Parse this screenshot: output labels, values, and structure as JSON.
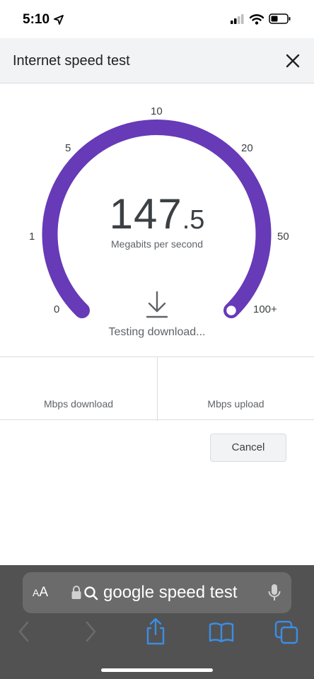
{
  "status_bar": {
    "time": "5:10",
    "icons": [
      "location-arrow-icon",
      "cellular-signal-icon",
      "wifi-icon",
      "battery-icon"
    ]
  },
  "dialog": {
    "title": "Internet speed test",
    "close_icon": "close-icon"
  },
  "gauge": {
    "tick_labels": [
      "0",
      "1",
      "5",
      "10",
      "20",
      "50",
      "100+"
    ],
    "speed_integer": "147",
    "speed_decimal": ".5",
    "unit_label": "Megabits per second",
    "status_text": "Testing download...",
    "accent_color": "#673ab7",
    "progress_fraction": 1.0
  },
  "results": {
    "download_label": "Mbps download",
    "upload_label": "Mbps upload"
  },
  "actions": {
    "cancel_label": "Cancel"
  },
  "browser": {
    "aa_small": "A",
    "aa_big": "A",
    "url_text": "google speed test",
    "toolbar_icons": [
      "back-icon",
      "forward-icon",
      "share-icon",
      "bookmarks-icon",
      "tabs-icon"
    ],
    "toolbar_color": "#3a8ee6"
  }
}
